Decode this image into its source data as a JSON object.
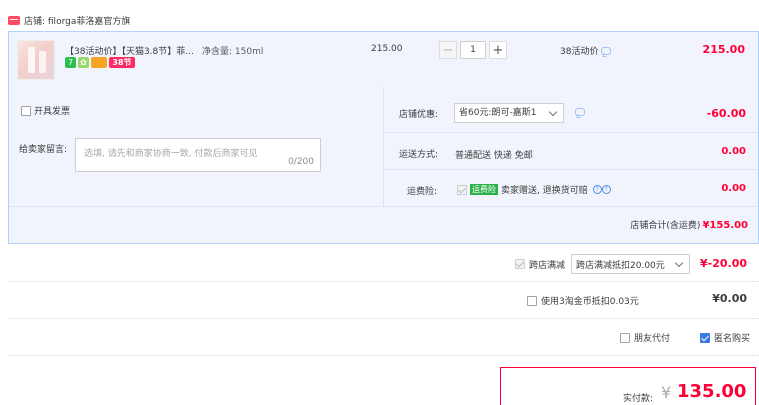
{
  "shop": {
    "label": "店铺: filorga菲洛嘉官方旗"
  },
  "item": {
    "title": "【38活动价】【天猫3.8节】菲...",
    "spec": "净含量: 150ml",
    "badges": [
      "7",
      "✿",
      "",
      "38节"
    ],
    "unit_price": "215.00",
    "quantity": "1",
    "minus": "−",
    "plus": "+",
    "promo": "38活动价",
    "subtotal": "215.00"
  },
  "invoice": {
    "label": "开具发票"
  },
  "message": {
    "label": "给卖家留言:",
    "placeholder": "选填, 请先和商家协商一致, 付款后商家可见",
    "count": "0/200"
  },
  "shop_discount": {
    "label": "店铺优惠:",
    "selected": "省60元:朗可-嘉斯1",
    "amount": "-60.00"
  },
  "shipping": {
    "label": "运送方式:",
    "value": "普通配送 快递 免邮",
    "amount": "0.00"
  },
  "insurance": {
    "label": "运费险:",
    "tag": "运费险",
    "text": "卖家赠送, 退换货可赔",
    "amount": "0.00",
    "help": [
      "?",
      "?"
    ]
  },
  "shop_total": {
    "label": "店铺合计(含运费)",
    "amount": "¥155.00"
  },
  "cross_store": {
    "label": "跨店满减",
    "selected": "跨店满减抵扣20.00元",
    "amount": "¥-20.00"
  },
  "coin": {
    "label": "使用3淘金币抵扣0.03元",
    "amount": "¥0.00"
  },
  "friend_pay": {
    "label": "朋友代付"
  },
  "anonymous": {
    "label": "匿名购买"
  },
  "payment": {
    "label": "实付款:",
    "currency": "¥",
    "amount": "135.00"
  },
  "colors": {
    "accent": "#ff0036",
    "panel_bg": "#f1f4fd",
    "panel_border": "#b2d1ff",
    "checkbox_blue": "#3b79e4"
  }
}
